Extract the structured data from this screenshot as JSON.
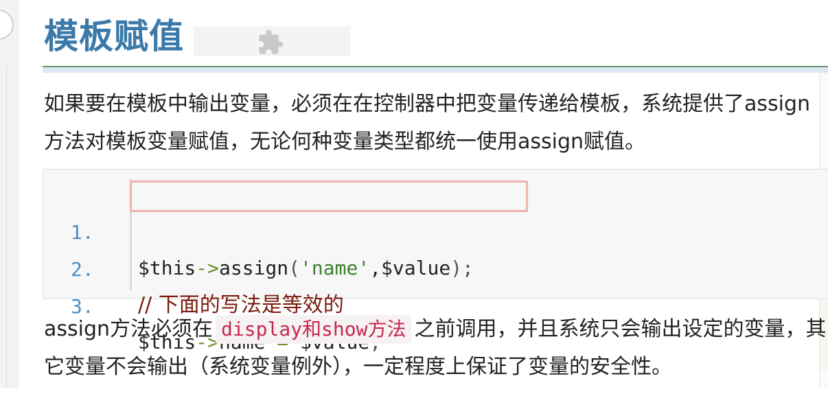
{
  "heading": {
    "title": "模板赋值"
  },
  "intro": {
    "text": "如果要在模板中输出变量，必须在在控制器中把变量传递给模板，系统提供了assign方法对模板变量赋值，无论何种变量类型都统一使用assign赋值。"
  },
  "code": {
    "lines": [
      {
        "number": "1.",
        "parts": [
          "$this",
          "->",
          "assign",
          "(",
          "'name'",
          ",$value",
          ");"
        ]
      },
      {
        "number": "2.",
        "comment": "// 下面的写法是等效的"
      },
      {
        "number": "3.",
        "parts": [
          "$this",
          "->",
          "name",
          " = ",
          "$value",
          ";"
        ]
      }
    ]
  },
  "note": {
    "before": "assign方法必须在",
    "inline_code": "display和show方法",
    "after": "之前调用，并且系统只会输出设定的变量，其它变量不会输出（系统变量例外），一定程度上保证了变量的安全性。"
  },
  "icons": {
    "extension": "puzzle-icon"
  },
  "colors": {
    "heading": "#3a79a8",
    "inline_code_text": "#c7254e",
    "highlight_border": "#efb3ad",
    "line_number": "#4a8fc7",
    "comment": "#7a1a0c",
    "string": "#3f7f2f"
  }
}
